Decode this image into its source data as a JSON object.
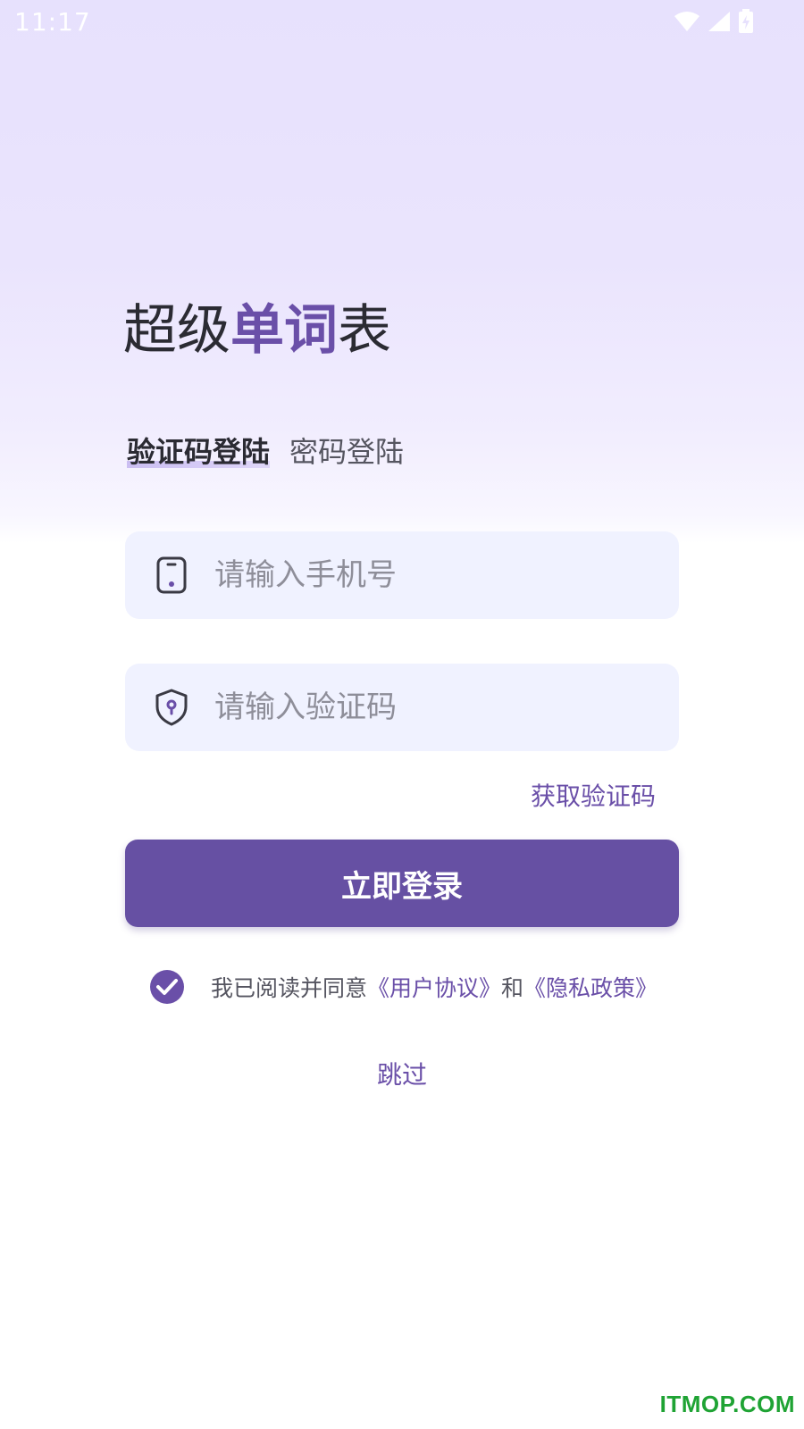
{
  "status_bar": {
    "time": "11:17",
    "icons": [
      "wifi-icon",
      "signal-icon",
      "battery-charging-icon"
    ]
  },
  "app": {
    "title_part1": "超级",
    "title_accent": "单词",
    "title_part2": "表"
  },
  "tabs": [
    {
      "label": "验证码登陆",
      "active": true
    },
    {
      "label": "密码登陆",
      "active": false
    }
  ],
  "form": {
    "phone_placeholder": "请输入手机号",
    "phone_icon": "phone-icon",
    "code_placeholder": "请输入验证码",
    "code_icon": "shield-icon",
    "get_code_label": "获取验证码",
    "login_label": "立即登录"
  },
  "agreement": {
    "checked": true,
    "prefix": "我已阅读并同意",
    "user_agreement": "《用户协议》",
    "conjunction": "和",
    "privacy_policy": "《隐私政策》"
  },
  "skip_label": "跳过",
  "watermark": "ITMOP.COM",
  "colors": {
    "accent": "#6650a3",
    "link": "#6a4fa8",
    "field_bg": "#f0f2ff",
    "watermark": "#1fa334"
  }
}
